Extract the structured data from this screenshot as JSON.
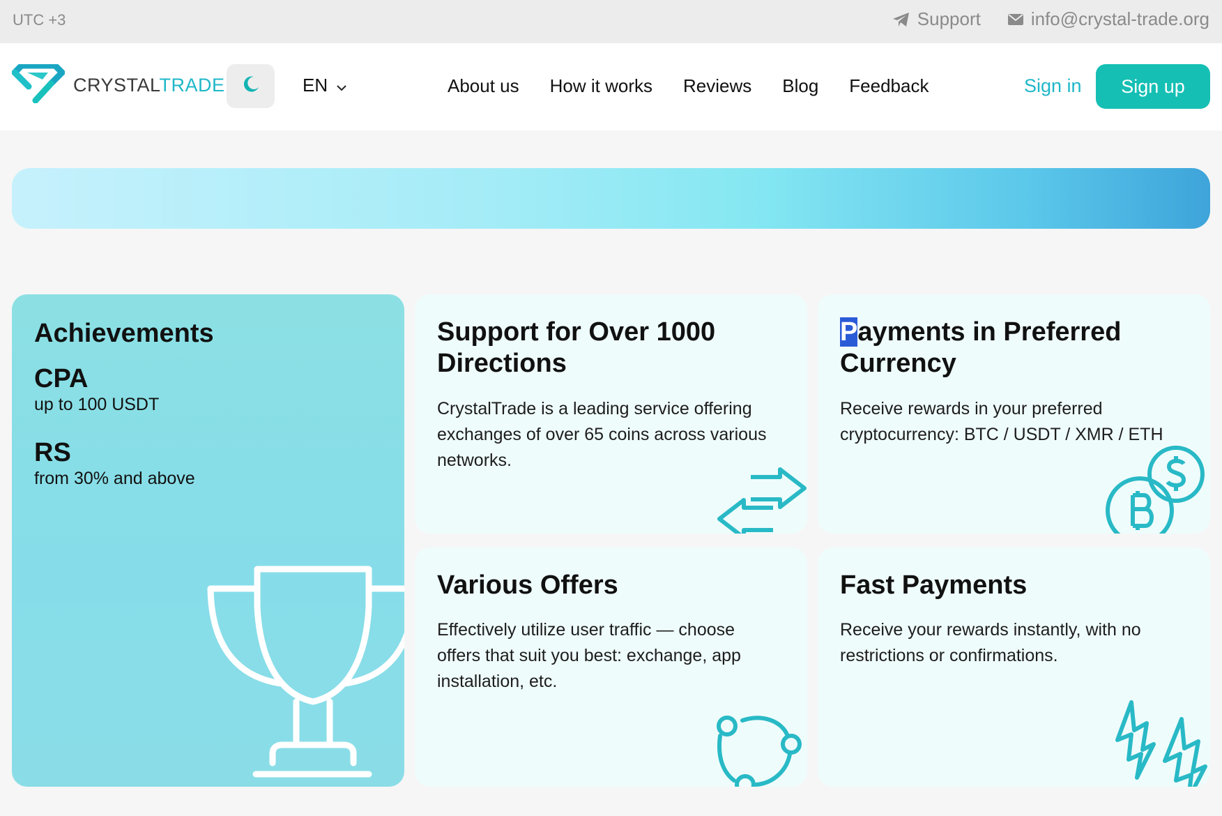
{
  "topbar": {
    "timezone": "UTC +3",
    "support_label": "Support",
    "email": "info@crystal-trade.org"
  },
  "header": {
    "logo_part1": "CRYSTAL",
    "logo_part2": "TRADE",
    "language": "EN",
    "nav": [
      "About us",
      "How it works",
      "Reviews",
      "Blog",
      "Feedback"
    ],
    "sign_in": "Sign in",
    "sign_up": "Sign up"
  },
  "cards": {
    "achievements": {
      "title": "Achievements",
      "items": [
        {
          "key": "CPA",
          "value": "up to 100 USDT"
        },
        {
          "key": "RS",
          "value": "from 30% and above"
        }
      ]
    },
    "directions": {
      "title": "Support for Over 1000 Directions",
      "text": "CrystalTrade is a leading service offering exchanges of over 65 coins across various networks."
    },
    "currency": {
      "title_first": "P",
      "title_rest": "ayments in Preferred Currency",
      "text": "Receive rewards in your preferred cryptocurrency: BTC / USDT / XMR / ETH"
    },
    "offers": {
      "title": "Various Offers",
      "text": "Effectively utilize user traffic — choose offers that suit you best: exchange, app installation, etc."
    },
    "fast": {
      "title": "Fast Payments",
      "text": "Receive your rewards instantly, with no restrictions or confirmations."
    }
  },
  "colors": {
    "accent": "#15bfb4",
    "link": "#1fb7c8",
    "card_bg": "#effcfc",
    "icon_stroke": "#29b9c6"
  }
}
